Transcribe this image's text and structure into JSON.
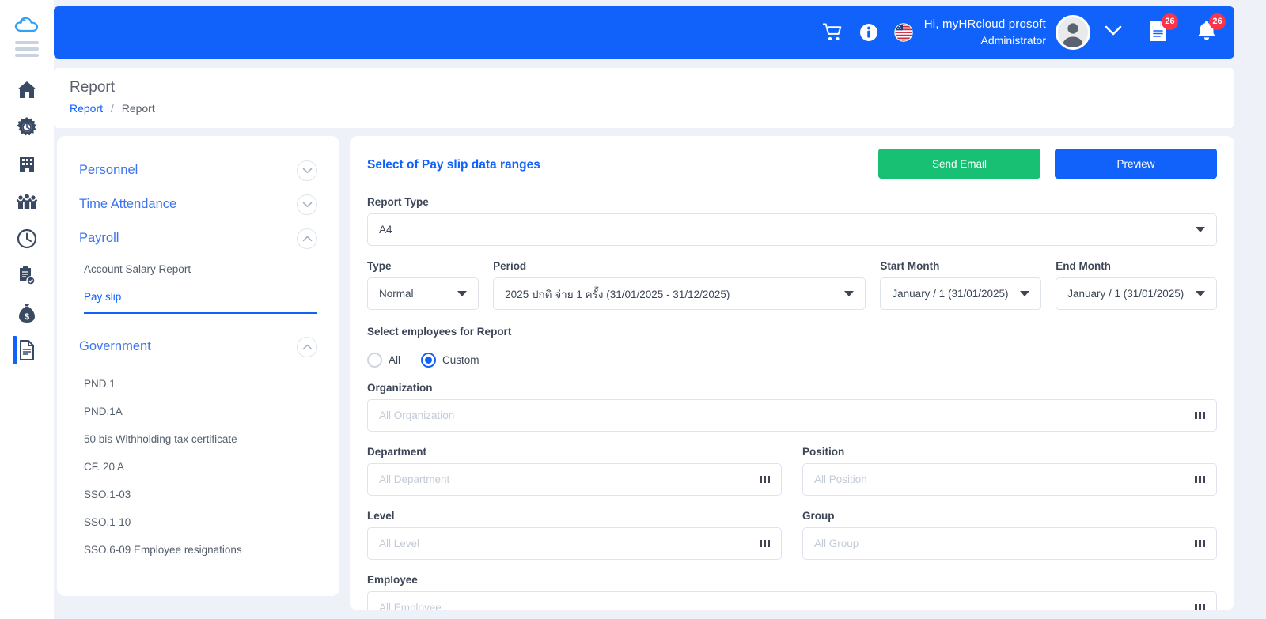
{
  "rail": {
    "logo_icon": "cloud-icon",
    "menu_icon": "hamburger-icon",
    "items": [
      {
        "name": "home-icon"
      },
      {
        "name": "settings-gear-icon"
      },
      {
        "name": "company-building-icon"
      },
      {
        "name": "personnel-people-icon"
      },
      {
        "name": "time-attendance-clock-icon"
      },
      {
        "name": "approval-clipboard-icon"
      },
      {
        "name": "payroll-moneybag-icon"
      },
      {
        "name": "report-document-icon"
      }
    ]
  },
  "topbar": {
    "cart_icon": "shopping-cart-icon",
    "info_icon": "info-circle-icon",
    "flag_icon": "us-flag-icon",
    "greeting": "Hi,  myHRcloud  prosoft",
    "role": "Administrator",
    "avatar_icon": "user-avatar-icon",
    "chevron_icon": "chevron-down-icon",
    "document_icon": "document-notification-icon",
    "document_badge": "26",
    "bell_icon": "bell-notification-icon",
    "bell_badge": "26"
  },
  "header": {
    "title": "Report",
    "breadcrumb_link": "Report",
    "breadcrumb_sep": "/",
    "breadcrumb_current": "Report"
  },
  "menu": {
    "groups": [
      {
        "label": "Personnel",
        "caret": "chevron-down-icon",
        "expanded": false
      },
      {
        "label": "Time  Attendance",
        "caret": "chevron-down-icon",
        "expanded": false
      },
      {
        "label": "Payroll",
        "caret": "chevron-up-icon",
        "expanded": true
      },
      {
        "label": "Government",
        "caret": "chevron-up-icon",
        "expanded": true
      }
    ],
    "payroll_items": [
      {
        "label": "Account Salary Report",
        "active": false
      },
      {
        "label": "Pay slip",
        "active": true
      }
    ],
    "government_items": [
      {
        "label": "PND.1"
      },
      {
        "label": "PND.1A"
      },
      {
        "label": "50 bis Withholding tax certificate"
      },
      {
        "label": "CF. 20 A"
      },
      {
        "label": "SSO.1-03"
      },
      {
        "label": "SSO.1-10"
      },
      {
        "label": "SSO.6-09 Employee resignations"
      }
    ]
  },
  "main": {
    "section_title": "Select of Pay slip data ranges",
    "send_email_label": "Send Email",
    "preview_label": "Preview",
    "report_type": {
      "label": "Report Type",
      "value": "A4"
    },
    "type": {
      "label": "Type",
      "value": "Normal"
    },
    "period": {
      "label": "Period",
      "value": "2025 ปกติ จ่าย 1 ครั้ง (31/01/2025 - 31/12/2025)"
    },
    "start_month": {
      "label": "Start Month",
      "value": "January / 1 (31/01/2025)"
    },
    "end_month": {
      "label": "End Month",
      "value": "January / 1 (31/01/2025)"
    },
    "employees_selector": {
      "label": "Select employees for Report",
      "option_all": "All",
      "option_custom": "Custom",
      "selected": "Custom"
    },
    "organization": {
      "label": "Organization",
      "placeholder": "All Organization",
      "value": ""
    },
    "department": {
      "label": "Department",
      "placeholder": "All Department",
      "value": ""
    },
    "position": {
      "label": "Position",
      "placeholder": "All Position",
      "value": ""
    },
    "level": {
      "label": "Level",
      "placeholder": "All Level",
      "value": ""
    },
    "group": {
      "label": "Group",
      "placeholder": "All Group",
      "value": ""
    },
    "employee": {
      "label": "Employee",
      "placeholder": "All Employee",
      "value": ""
    }
  },
  "colors": {
    "brand_blue": "#1062fb",
    "success_green": "#17c073",
    "badge_red": "#fb3449",
    "page_bg": "#eef1f7",
    "dark_icon": "#3a4a63"
  }
}
